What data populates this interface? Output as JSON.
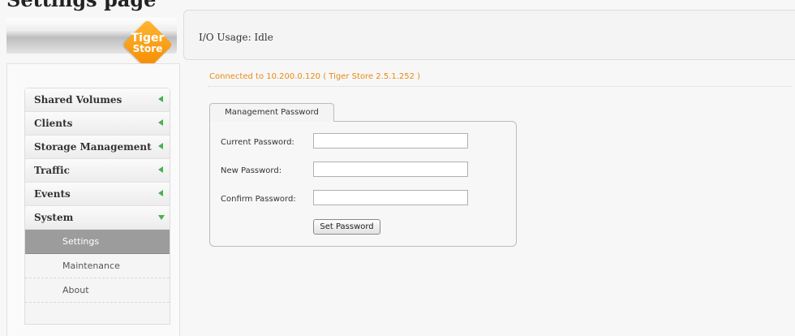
{
  "page": {
    "title": "Settings page"
  },
  "logo": {
    "line1": "Tiger",
    "line2": "Store"
  },
  "header": {
    "io_usage": "I/O Usage: Idle"
  },
  "status": {
    "connected": "Connected to 10.200.0.120  ( Tiger Store 2.5.1.252 )"
  },
  "sidebar": {
    "items": [
      {
        "label": "Shared Volumes"
      },
      {
        "label": "Clients"
      },
      {
        "label": "Storage Management"
      },
      {
        "label": "Traffic"
      },
      {
        "label": "Events"
      },
      {
        "label": "System"
      }
    ],
    "system_subitems": [
      {
        "label": "Settings",
        "active": true
      },
      {
        "label": "Maintenance"
      },
      {
        "label": "About"
      }
    ]
  },
  "form": {
    "tab_label": "Management Password",
    "current_label": "Current Password:",
    "new_label": "New Password:",
    "confirm_label": "Confirm Password:",
    "current_value": "",
    "new_value": "",
    "confirm_value": "",
    "submit_label": "Set Password"
  },
  "colors": {
    "accent_orange": "#f58a00",
    "status_text": "#e88b12",
    "arrow_green": "#4caf50",
    "active_item": "#9c9c9c"
  },
  "icons": {
    "collapsed": "triangle-left-icon",
    "expanded": "triangle-down-icon"
  }
}
